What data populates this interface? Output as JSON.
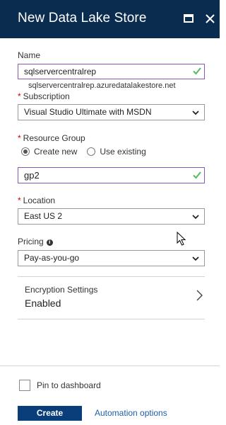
{
  "window": {
    "title": "New Data Lake Store",
    "maximize_icon": "maximize-icon",
    "close_icon": "close-icon"
  },
  "form": {
    "name": {
      "label": "Name",
      "value": "sqlservercentralrep",
      "hint": "sqlservercentralrep.azuredatalakestore.net"
    },
    "subscription": {
      "label": "Subscription",
      "value": "Visual Studio Ultimate with MSDN"
    },
    "resource_group": {
      "label": "Resource Group",
      "options": [
        "Create new",
        "Use existing"
      ],
      "selected": "Create new",
      "value": "gp2"
    },
    "location": {
      "label": "Location",
      "value": "East US 2"
    },
    "pricing": {
      "label": "Pricing",
      "value": "Pay-as-you-go"
    },
    "encryption": {
      "title": "Encryption Settings",
      "value": "Enabled"
    }
  },
  "footer": {
    "pin_label": "Pin to dashboard",
    "pin_checked": false,
    "create_label": "Create",
    "automation_label": "Automation options"
  },
  "colors": {
    "titlebar": "#0a2c4f",
    "valid_border": "#8a59b3",
    "check": "#5cb85c",
    "required": "#cc0000",
    "primary_button": "#0a3e7a",
    "link": "#1e5eab"
  }
}
